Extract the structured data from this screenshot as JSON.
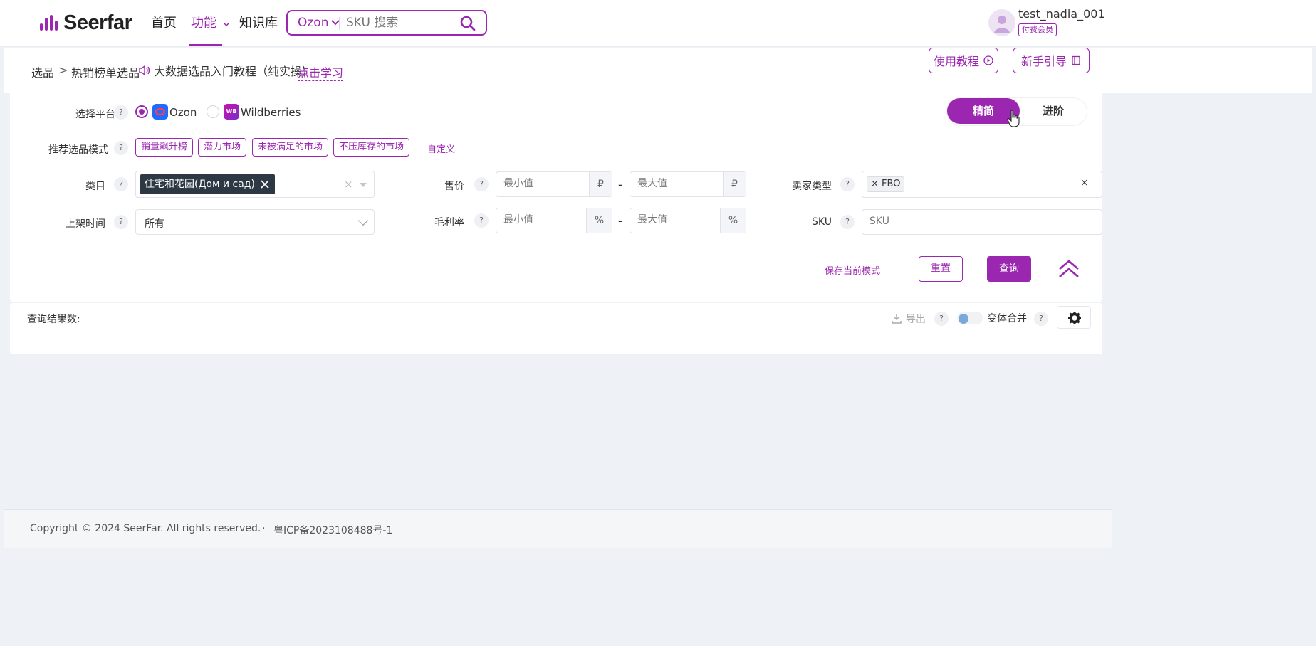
{
  "brand": {
    "name": "Seerfar",
    "accent": "#9b27b0"
  },
  "nav": {
    "items": [
      {
        "label": "首页"
      },
      {
        "label": "功能",
        "active": true,
        "has_dropdown": true
      },
      {
        "label": "知识库"
      }
    ]
  },
  "search": {
    "platform": "Ozon",
    "placeholder": "SKU 搜索",
    "icon": "search-icon"
  },
  "user": {
    "name": "test_nadia_001",
    "badge": "付费会员"
  },
  "breadcrumb": {
    "items": [
      "选品",
      ">",
      "热销榜单选品"
    ],
    "tutorial_text": "大数据选品入门教程（纯实操）",
    "learn_link": "点击学习"
  },
  "header_buttons": {
    "tutorial": "使用教程",
    "guide": "新手引导"
  },
  "filters": {
    "platform_label": "选择平台",
    "platforms": [
      {
        "name": "Ozon",
        "selected": true
      },
      {
        "name": "Wildberries",
        "selected": false,
        "icon_text": "WB"
      }
    ],
    "segment": {
      "simple": "精简",
      "advanced": "进阶",
      "active": "simple"
    },
    "mode_label": "推荐选品模式",
    "modes": [
      "销量飙升榜",
      "潜力市场",
      "未被满足的市场",
      "不压库存的市场"
    ],
    "custom_mode": "自定义",
    "category": {
      "label": "类目",
      "selected_tag": "住宅和花园(Дом и сад)"
    },
    "listing_time": {
      "label": "上架时间",
      "value": "所有"
    },
    "price": {
      "label": "售价",
      "min_placeholder": "最小值",
      "max_placeholder": "最大值",
      "unit": "₽"
    },
    "margin": {
      "label": "毛利率",
      "min_placeholder": "最小值",
      "max_placeholder": "最大值",
      "unit": "%"
    },
    "seller_type": {
      "label": "卖家类型",
      "tag": "FBO"
    },
    "sku": {
      "label": "SKU",
      "placeholder": "SKU"
    },
    "dash": "-",
    "qmark": "?"
  },
  "actions": {
    "save_mode": "保存当前模式",
    "reset": "重置",
    "query": "查询"
  },
  "results": {
    "count_label": "查询结果数:",
    "export": "导出",
    "merge_variants": "变体合并",
    "merge_enabled": false
  },
  "footer": {
    "copyright": "Copyright © 2024 SeerFar. All rights reserved.",
    "separator": "·",
    "icp": "粤ICP备2023108488号-1"
  }
}
